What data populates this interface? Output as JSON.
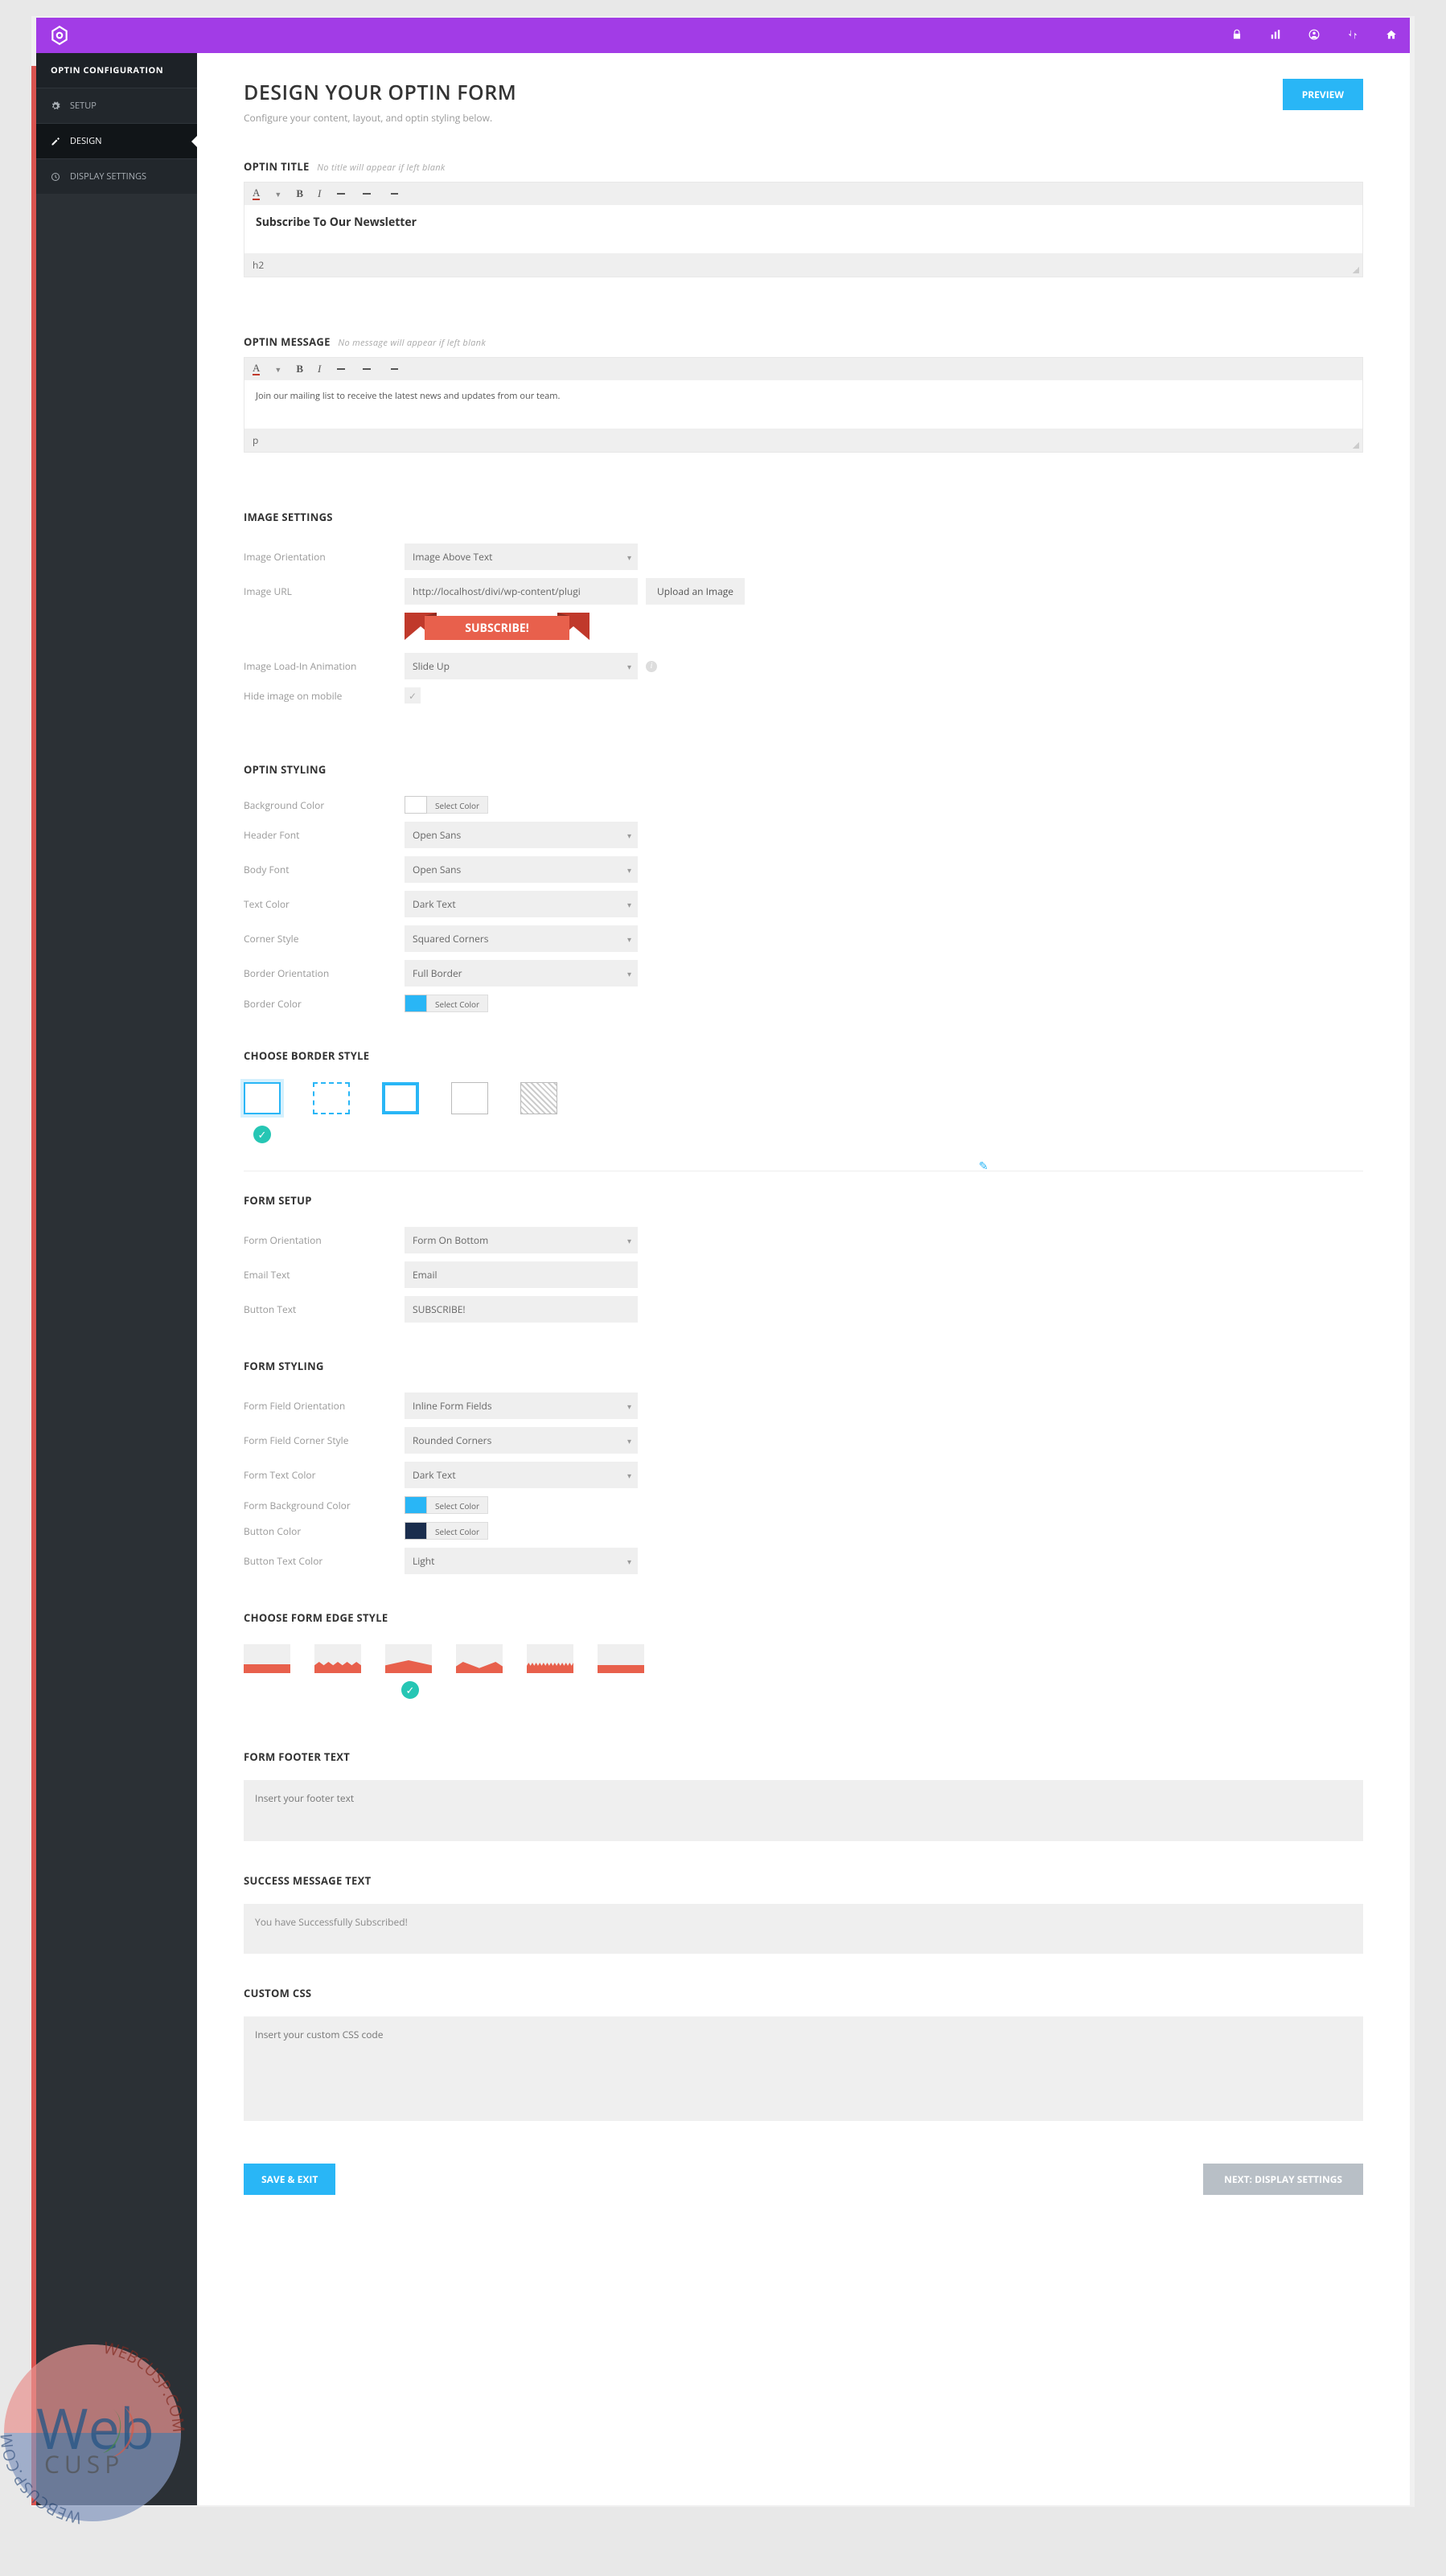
{
  "sidebar": {
    "header": "OPTIN CONFIGURATION",
    "items": [
      {
        "label": "SETUP"
      },
      {
        "label": "DESIGN"
      },
      {
        "label": "DISPLAY SETTINGS"
      }
    ]
  },
  "header": {
    "title": "DESIGN YOUR OPTIN FORM",
    "subtitle": "Configure your content, layout, and optin styling below.",
    "preview_btn": "PREVIEW"
  },
  "optin_title": {
    "label": "OPTIN TITLE",
    "hint": "No title will appear if left blank",
    "value": "Subscribe To Our Newsletter",
    "tag": "h2"
  },
  "optin_message": {
    "label": "OPTIN MESSAGE",
    "hint": "No message will appear if left blank",
    "value": "Join our mailing list to receive the latest news and updates from our team.",
    "tag": "p"
  },
  "image_settings": {
    "heading": "IMAGE SETTINGS",
    "orientation_label": "Image Orientation",
    "orientation_value": "Image Above Text",
    "url_label": "Image URL",
    "url_value": "http://localhost/divi/wp-content/plugi",
    "upload_btn": "Upload an Image",
    "ribbon_text": "SUBSCRIBE!",
    "animation_label": "Image Load-In Animation",
    "animation_value": "Slide Up",
    "hide_label": "Hide image on mobile"
  },
  "optin_styling": {
    "heading": "OPTIN STYLING",
    "bg_label": "Background Color",
    "header_font_label": "Header Font",
    "header_font_value": "Open Sans",
    "body_font_label": "Body Font",
    "body_font_value": "Open Sans",
    "text_color_label": "Text Color",
    "text_color_value": "Dark Text",
    "corner_label": "Corner Style",
    "corner_value": "Squared Corners",
    "border_orient_label": "Border Orientation",
    "border_orient_value": "Full Border",
    "border_color_label": "Border Color",
    "select_color": "Select Color"
  },
  "border_style": {
    "heading": "CHOOSE BORDER STYLE"
  },
  "form_setup": {
    "heading": "FORM SETUP",
    "orientation_label": "Form Orientation",
    "orientation_value": "Form On Bottom",
    "email_label": "Email Text",
    "email_value": "Email",
    "button_label": "Button Text",
    "button_value": "SUBSCRIBE!"
  },
  "form_styling": {
    "heading": "FORM STYLING",
    "field_orient_label": "Form Field Orientation",
    "field_orient_value": "Inline Form Fields",
    "corner_label": "Form Field Corner Style",
    "corner_value": "Rounded Corners",
    "text_color_label": "Form Text Color",
    "text_color_value": "Dark Text",
    "bg_label": "Form Background Color",
    "btn_color_label": "Button Color",
    "btn_text_label": "Button Text Color",
    "btn_text_value": "Light",
    "select_color": "Select Color"
  },
  "edge_style": {
    "heading": "CHOOSE FORM EDGE STYLE"
  },
  "footer_text": {
    "heading": "FORM FOOTER TEXT",
    "placeholder": "Insert your footer text"
  },
  "success_text": {
    "heading": "SUCCESS MESSAGE TEXT",
    "value": "You have Successfully Subscribed!"
  },
  "custom_css": {
    "heading": "CUSTOM CSS",
    "placeholder": "Insert your custom CSS code"
  },
  "footer": {
    "save": "SAVE & EXIT",
    "next": "NEXT: DISPLAY SETTINGS"
  }
}
